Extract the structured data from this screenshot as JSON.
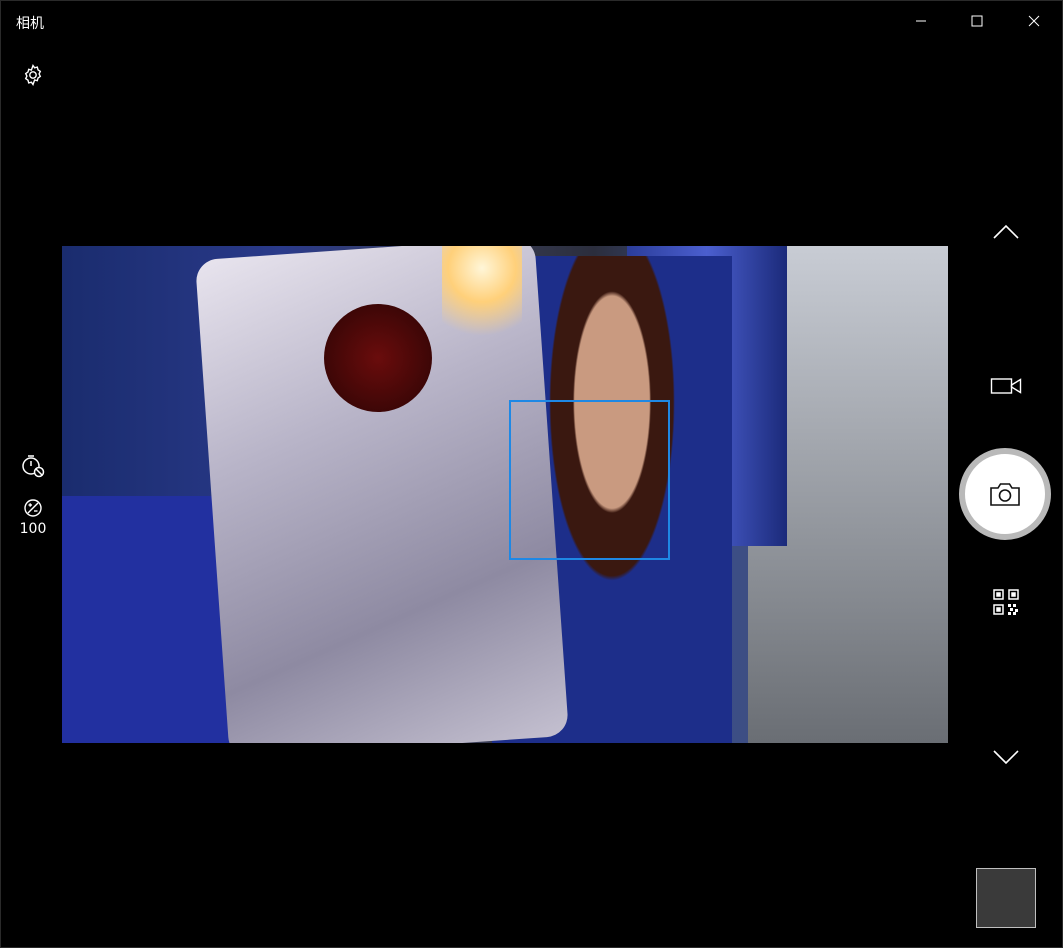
{
  "window": {
    "title": "相机"
  },
  "controls": {
    "settings_icon": "gear-icon",
    "timer_icon": "timer-off-icon",
    "exposure_icon": "exposure-icon",
    "exposure_value": "100",
    "nav_up_icon": "chevron-up-icon",
    "video_mode_icon": "video-camera-icon",
    "shutter_icon": "camera-icon",
    "qr_mode_icon": "qr-code-icon",
    "nav_down_icon": "chevron-down-icon"
  },
  "colors": {
    "background": "#000000",
    "face_box": "#1e88e5",
    "shutter_ring": "#b9b9b9",
    "thumbnail": "#3a3a3a"
  }
}
